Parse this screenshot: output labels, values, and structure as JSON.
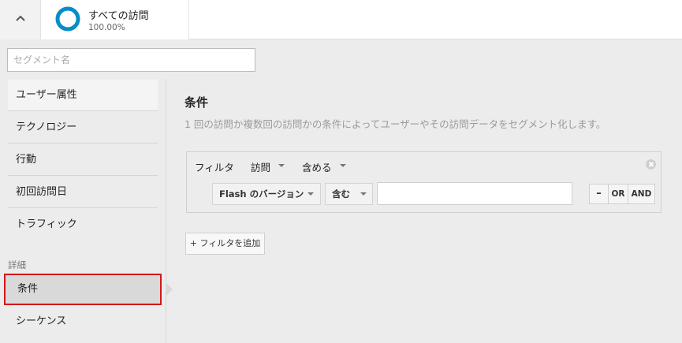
{
  "segment": {
    "name": "すべての訪問",
    "percent": "100.00%",
    "ring_color": "#058dc7"
  },
  "segment_name_input": {
    "placeholder": "セグメント名",
    "value": ""
  },
  "sidebar": {
    "items": [
      {
        "label": "ユーザー属性"
      },
      {
        "label": "テクノロジー"
      },
      {
        "label": "行動"
      },
      {
        "label": "初回訪問日"
      },
      {
        "label": "トラフィック"
      }
    ],
    "section_label": "詳細",
    "advanced_items": [
      {
        "label": "条件",
        "selected": true
      },
      {
        "label": "シーケンス"
      }
    ],
    "highlight_color": "#d0191b"
  },
  "main": {
    "title": "条件",
    "description": "1 回の訪問か複数回の訪問かの条件によってユーザーやその訪問データをセグメント化します。",
    "filter": {
      "label": "フィルタ",
      "scope": "訪問",
      "include": "含める",
      "dimension": "Flash のバージョン",
      "operator": "含む",
      "value": "",
      "minus_label": "–",
      "or_label": "OR",
      "and_label": "AND"
    },
    "add_filter_label": "+ フィルタを追加"
  }
}
